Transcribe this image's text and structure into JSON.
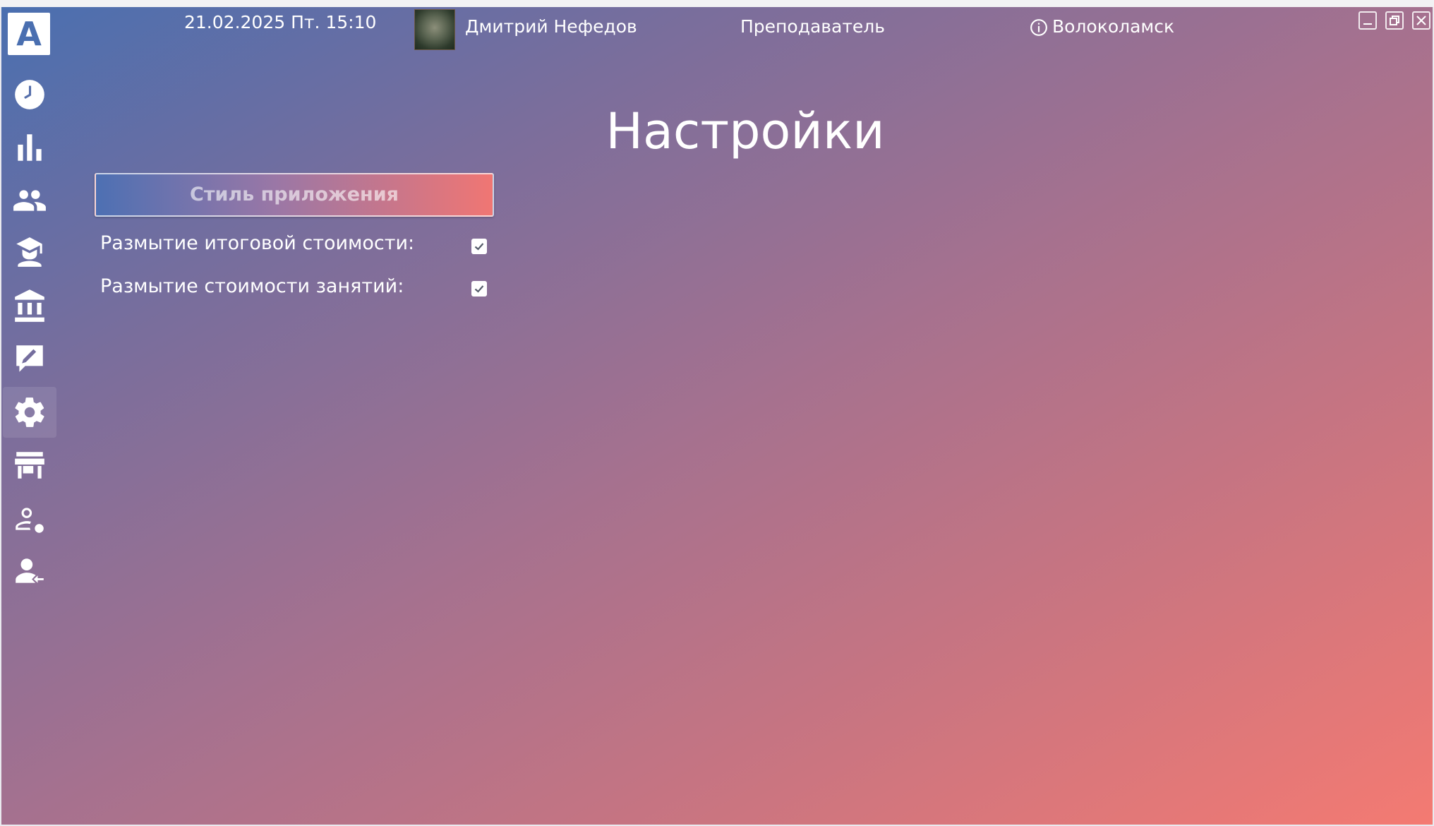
{
  "header": {
    "datetime": "21.02.2025 Пт. 15:10",
    "user_name": "Дмитрий Нефедов",
    "role": "Преподаватель",
    "city": "Волоколамск"
  },
  "logo": {
    "letter": "A"
  },
  "sidebar": {
    "items": [
      {
        "icon": "clock-icon"
      },
      {
        "icon": "bar-chart-icon"
      },
      {
        "icon": "group-icon"
      },
      {
        "icon": "student-icon"
      },
      {
        "icon": "bank-icon"
      },
      {
        "icon": "edit-icon"
      },
      {
        "icon": "gear-icon",
        "active": true
      },
      {
        "icon": "store-icon"
      },
      {
        "icon": "user-settings-icon"
      },
      {
        "icon": "user-logout-icon"
      }
    ]
  },
  "main": {
    "title": "Настройки",
    "style_button": "Стиль приложения",
    "settings": [
      {
        "label": "Размытие итоговой стоимости:",
        "checked": true
      },
      {
        "label": "Размытие стоимости занятий:",
        "checked": true
      }
    ]
  },
  "colors": {
    "gradient_start": "#4a6fb0",
    "gradient_end": "#f47a72"
  }
}
